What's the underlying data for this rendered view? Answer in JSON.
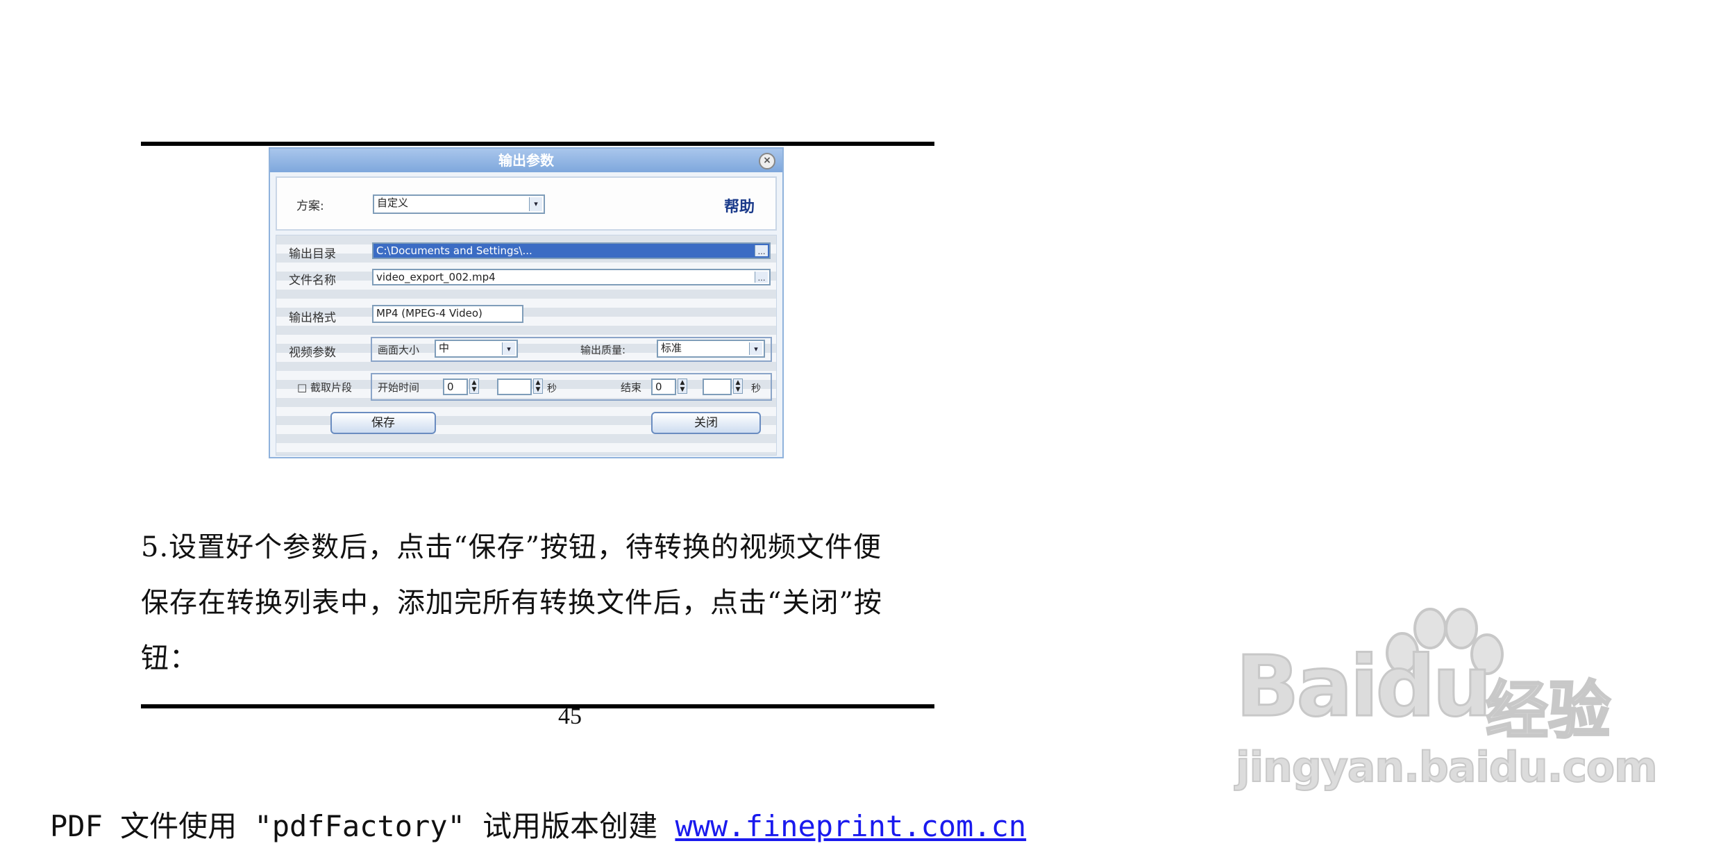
{
  "dialog": {
    "title": "输出参数",
    "close_label": "×",
    "preset_label": "方案:",
    "preset_value": "自定义",
    "help_label": "帮助",
    "row1_label": "输出目录",
    "row1_value": "C:\\Documents and Settings\\...",
    "row2_label": "文件名称",
    "row2_value": "video_export_002.mp4",
    "row3_label": "输出格式",
    "row3_value": "MP4 (MPEG-4 Video)",
    "row4_label": "视频参数",
    "row4_left_label": "画面大小",
    "row4_left_value": "中",
    "row4_right_label": "输出质量:",
    "row4_right_value": "标准",
    "row5_label": "□ 截取片段",
    "row5_start_label": "开始时间",
    "row5_start_value": "0",
    "row5_start_unit": "秒",
    "row5_end_label": "结束",
    "row5_end_value": "0",
    "row5_end_unit": "秒",
    "save_label": "保存",
    "close_button_label": "关闭"
  },
  "paragraph": {
    "line1": "5.设置好个参数后，点击“保存”按钮，待转换的视频文件便",
    "line2": "保存在转换列表中，添加完所有转换文件后，点击“关闭”按",
    "line3": "钮："
  },
  "page_number": "45",
  "footer": {
    "text": "PDF 文件使用 \"pdfFactory\" 试用版本创建 ",
    "link": "www.fineprint.com.cn"
  },
  "watermark": {
    "logo": "Baidu",
    "brand": "经验",
    "url": "jingyan.baidu.com"
  }
}
